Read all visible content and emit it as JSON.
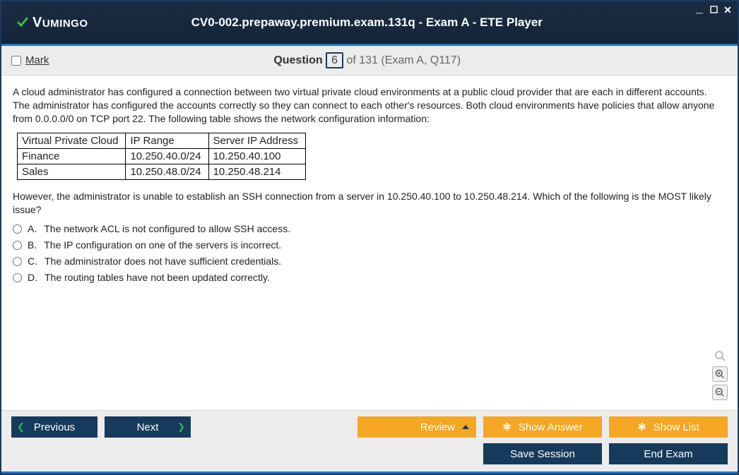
{
  "window": {
    "brand_prefix": "V",
    "brand_suffix": "UMINGO",
    "title": "CV0-002.prepaway.premium.exam.131q - Exam A - ETE Player",
    "min": "_",
    "max": "☐",
    "close": "✕"
  },
  "qbar": {
    "mark_label": "Mark",
    "prefix": "Question",
    "number": "6",
    "suffix": "of 131 (Exam A, Q117)"
  },
  "question": {
    "para1": "A cloud administrator has configured a connection between two virtual private cloud environments at a public cloud provider that are each in different accounts. The administrator has configured the accounts correctly so they can connect to each other's resources. Both cloud environments have policies that allow anyone from 0.0.0.0/0 on TCP port 22. The following table shows the network configuration information:",
    "para2": "However, the administrator is unable to establish an SSH connection from a server in 10.250.40.100 to 10.250.48.214. Which of the following is the MOST likely issue?",
    "table": {
      "headers": [
        "Virtual Private Cloud",
        "IP Range",
        "Server IP Address"
      ],
      "rows": [
        [
          "Finance",
          "10.250.40.0/24",
          "10.250.40.100"
        ],
        [
          "Sales",
          "10.250.48.0/24",
          "10.250.48.214"
        ]
      ]
    },
    "options": [
      {
        "letter": "A.",
        "text": "The network ACL is not configured to allow SSH access."
      },
      {
        "letter": "B.",
        "text": "The IP configuration on one of the servers is incorrect."
      },
      {
        "letter": "C.",
        "text": "The administrator does not have sufficient credentials."
      },
      {
        "letter": "D.",
        "text": "The routing tables have not been updated correctly."
      }
    ]
  },
  "footer": {
    "previous": "Previous",
    "next": "Next",
    "review": "Review",
    "show_answer": "Show Answer",
    "show_list": "Show List",
    "save_session": "Save Session",
    "end_exam": "End Exam"
  }
}
